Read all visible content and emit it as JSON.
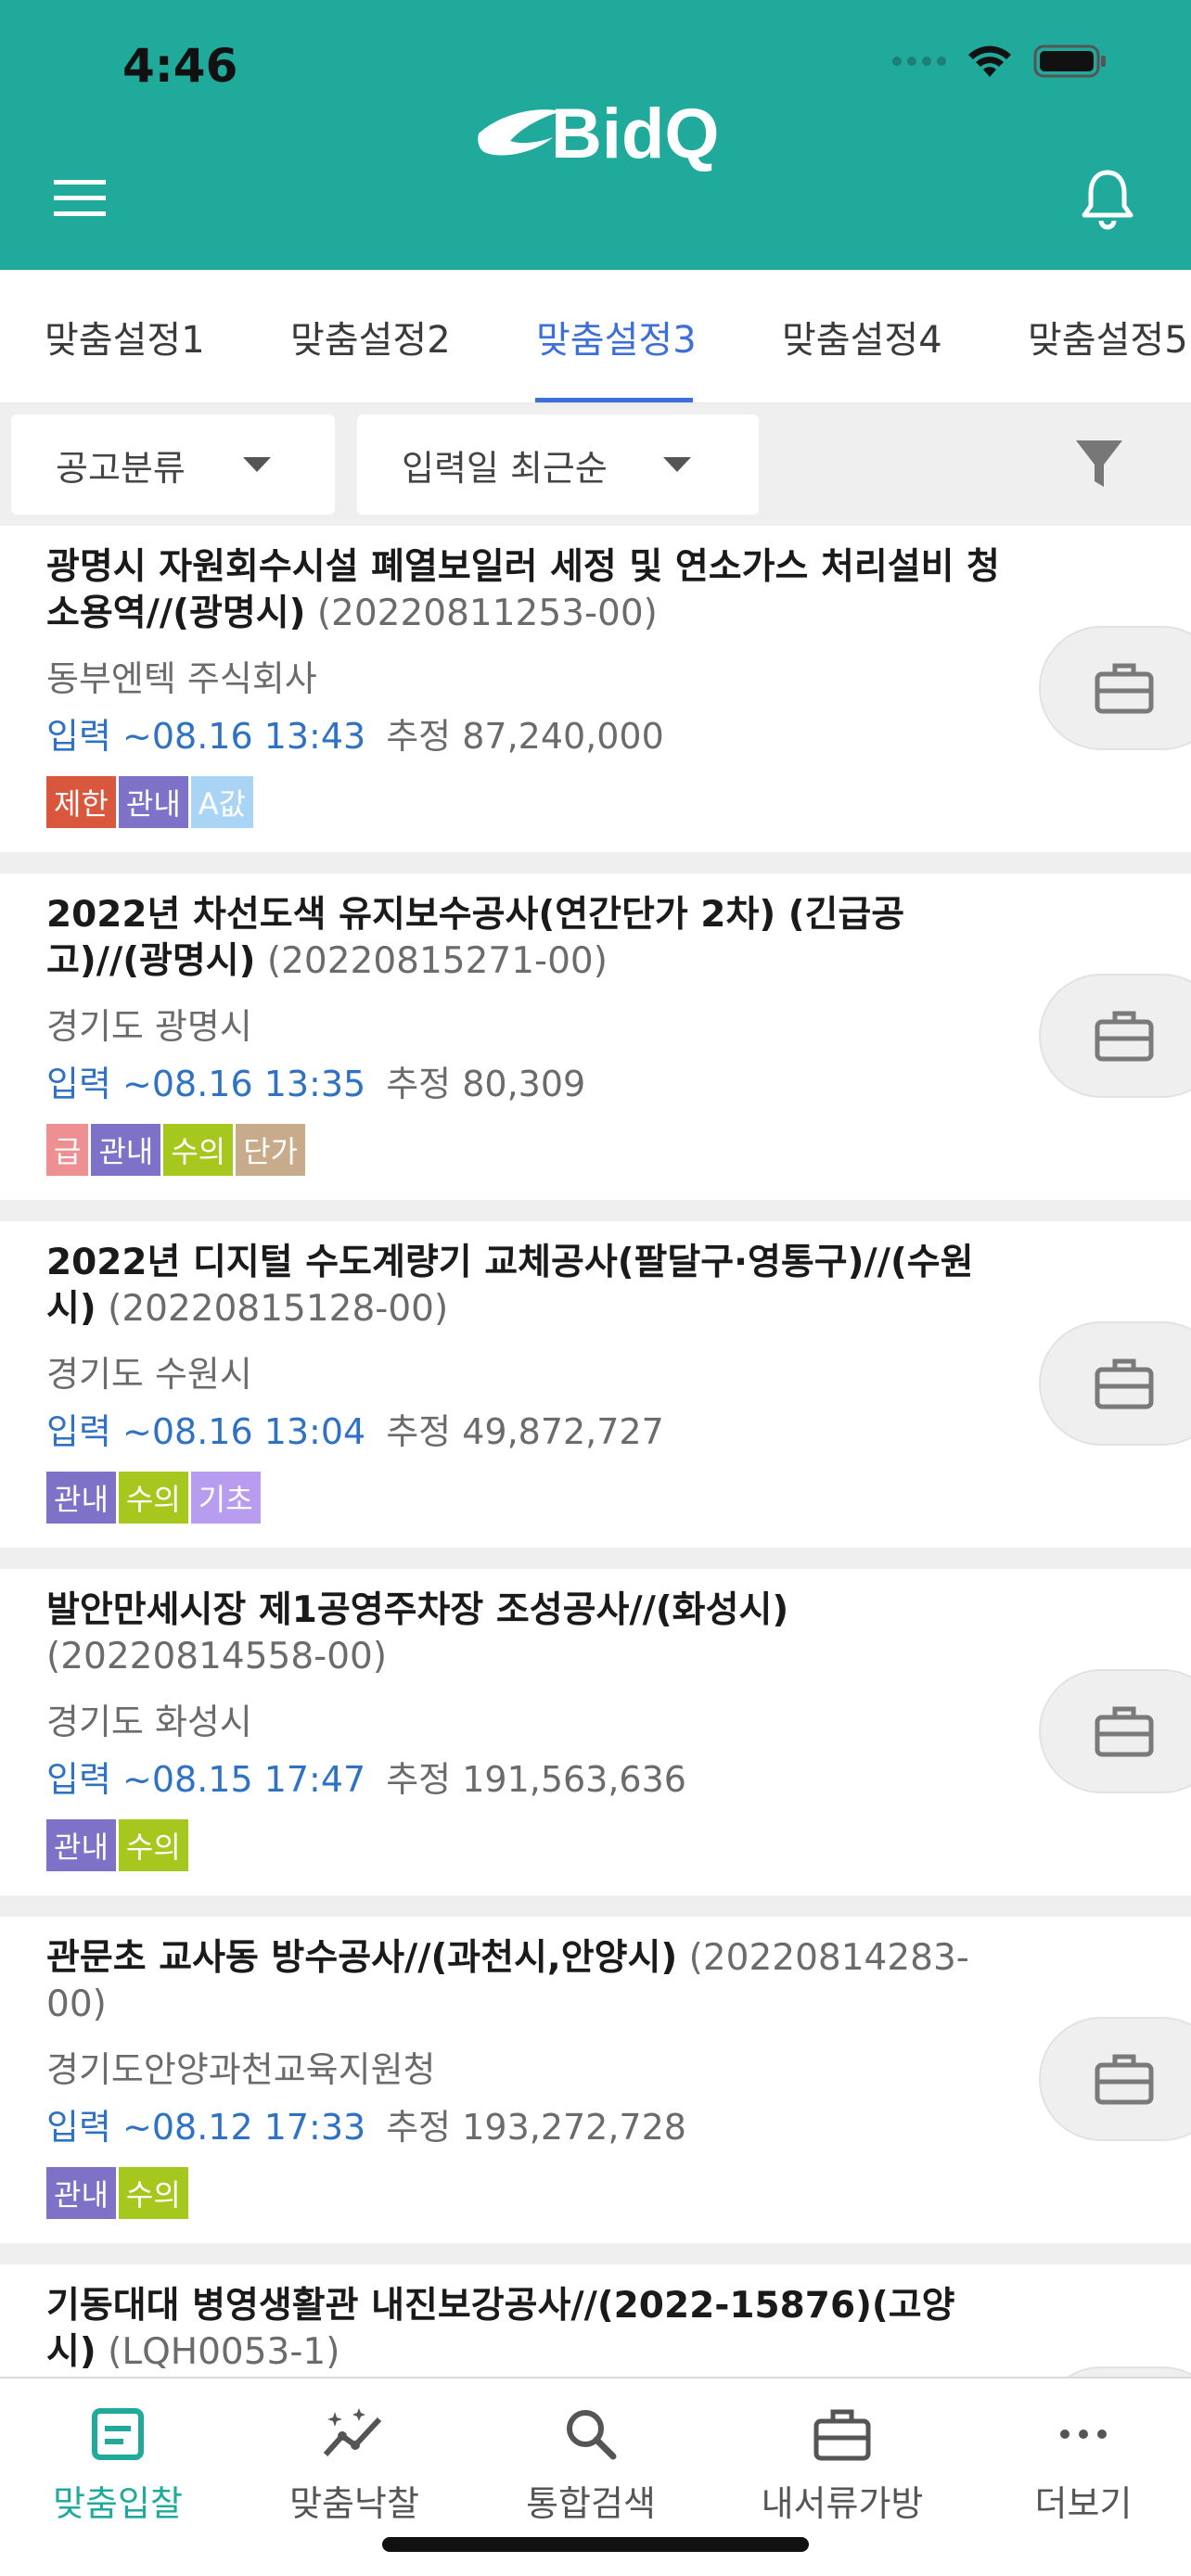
{
  "status_bar": {
    "time": "4:46"
  },
  "header": {
    "logo_text": "BidQ"
  },
  "tabs": [
    {
      "label": "맞춤설정1",
      "active": false
    },
    {
      "label": "맞춤설정2",
      "active": false
    },
    {
      "label": "맞춤설정3",
      "active": true
    },
    {
      "label": "맞춤설정4",
      "active": false
    },
    {
      "label": "맞춤설정5",
      "active": false
    }
  ],
  "filters": {
    "category": "공고분류",
    "sort": "입력일 최근순"
  },
  "colors": {
    "brand": "#1faa9c",
    "active_tab": "#3d6fd9",
    "date_text": "#2f72c4"
  },
  "bids": [
    {
      "title": "광명시 자원회수시설 폐열보일러 세정 및 연소가스 처리설비 청소용역//(광명시)",
      "code": "(20220811253-00)",
      "org": "동부엔텍 주식회사",
      "date": "입력 ~08.16 13:43",
      "estimate": "추정 87,240,000",
      "tags": [
        {
          "label": "제한",
          "color": "#d9573d"
        },
        {
          "label": "관내",
          "color": "#7d72c8"
        },
        {
          "label": "A값",
          "color": "#a9d4f5"
        }
      ]
    },
    {
      "title": "2022년 차선도색 유지보수공사(연간단가 2차) (긴급공고)//(광명시)",
      "code": "(20220815271-00)",
      "org": "경기도 광명시",
      "date": "입력 ~08.16 13:35",
      "estimate": "추정 80,309",
      "tags": [
        {
          "label": "급",
          "color": "#ee8f92"
        },
        {
          "label": "관내",
          "color": "#7d72c8"
        },
        {
          "label": "수의",
          "color": "#a6c81e"
        },
        {
          "label": "단가",
          "color": "#c7ab8a"
        }
      ]
    },
    {
      "title": "2022년 디지털 수도계량기 교체공사(팔달구·영통구)//(수원시)",
      "code": "(20220815128-00)",
      "org": "경기도 수원시",
      "date": "입력 ~08.16 13:04",
      "estimate": "추정 49,872,727",
      "tags": [
        {
          "label": "관내",
          "color": "#7d72c8"
        },
        {
          "label": "수의",
          "color": "#a6c81e"
        },
        {
          "label": "기초",
          "color": "#b89cf0"
        }
      ]
    },
    {
      "title": "발안만세시장 제1공영주차장 조성공사//(화성시)",
      "code": "(20220814558-00)",
      "org": "경기도 화성시",
      "date": "입력 ~08.15 17:47",
      "estimate": "추정 191,563,636",
      "tags": [
        {
          "label": "관내",
          "color": "#7d72c8"
        },
        {
          "label": "수의",
          "color": "#a6c81e"
        }
      ]
    },
    {
      "title": "관문초 교사동 방수공사//(과천시,안양시)",
      "code": "(20220814283-00)",
      "org": "경기도안양과천교육지원청",
      "date": "입력 ~08.12 17:33",
      "estimate": "추정 193,272,728",
      "tags": [
        {
          "label": "관내",
          "color": "#7d72c8"
        },
        {
          "label": "수의",
          "color": "#a6c81e"
        }
      ]
    },
    {
      "title": "기동대대 병영생활관 내진보강공사//(2022-15876)(고양시)",
      "code": "(LQH0053-1)",
      "org": "",
      "date": "",
      "estimate": "",
      "tags": []
    }
  ],
  "bottom_nav": [
    {
      "label": "맞춤입찰",
      "icon": "custom-bid-icon",
      "active": true
    },
    {
      "label": "맞춤낙찰",
      "icon": "award-sparkle-icon",
      "active": false
    },
    {
      "label": "통합검색",
      "icon": "search-icon",
      "active": false
    },
    {
      "label": "내서류가방",
      "icon": "briefcase-icon",
      "active": false
    },
    {
      "label": "더보기",
      "icon": "more-dots-icon",
      "active": false
    }
  ]
}
